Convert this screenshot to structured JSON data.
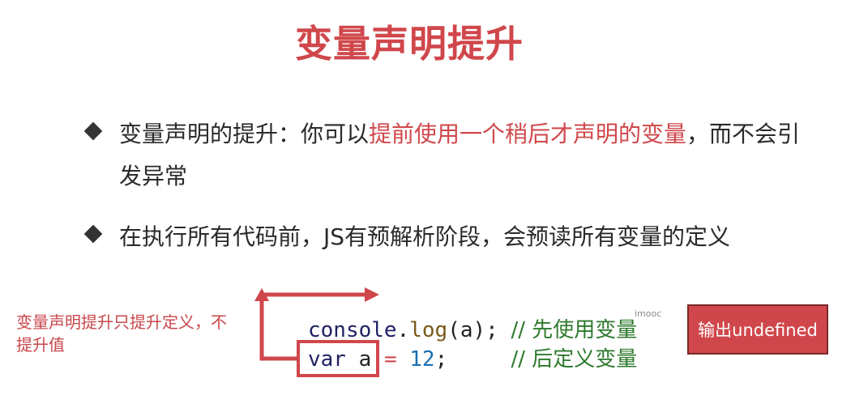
{
  "title": "变量声明提升",
  "bullets": [
    {
      "before": "变量声明的提升：你可以",
      "highlight": "提前使用一个稍后才声明的变量",
      "after": "，而不会引发异常"
    },
    {
      "text": "在执行所有代码前，JS有预解析阶段，会预读所有变量的定义"
    }
  ],
  "side_note": "变量声明提升只提升定义，不提升值",
  "code": {
    "line1": {
      "obj": "console",
      "dot": ".",
      "fn": "log",
      "args": "(a);",
      "comment": "// 先使用变量"
    },
    "line2": {
      "kw": "var",
      "name": "a",
      "op": "=",
      "num": "12",
      "semi": ";",
      "comment": "// 后定义变量"
    }
  },
  "watermark": "imooc",
  "output_label": "输出undefined",
  "colors": {
    "accent": "#d0474b",
    "comment": "#2d7a2d",
    "number": "#1a6fb0"
  }
}
